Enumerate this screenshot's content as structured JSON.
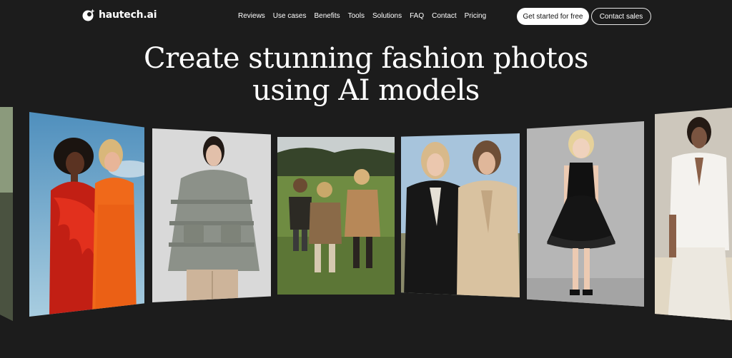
{
  "brand": {
    "name": "hautech.ai",
    "logo_icon": "hautech-logo-icon"
  },
  "nav": {
    "items": [
      {
        "label": "Reviews"
      },
      {
        "label": "Use cases"
      },
      {
        "label": "Benefits"
      },
      {
        "label": "Tools"
      },
      {
        "label": "Solutions"
      },
      {
        "label": "FAQ"
      },
      {
        "label": "Contact"
      },
      {
        "label": "Pricing"
      }
    ]
  },
  "cta": {
    "primary_label": "Get started for free",
    "secondary_label": "Contact sales"
  },
  "hero": {
    "title_line1": "Create stunning fashion photos",
    "title_line2": "using AI models"
  },
  "carousel": {
    "cards": [
      {
        "name": "edge-left-photo"
      },
      {
        "name": "two-women-red-orange-dresses-photo"
      },
      {
        "name": "woman-grey-puffer-jacket-photo"
      },
      {
        "name": "children-running-field-photo"
      },
      {
        "name": "two-women-suits-photo"
      },
      {
        "name": "girl-black-tulle-dress-photo"
      },
      {
        "name": "woman-white-outfit-photo"
      }
    ]
  },
  "colors": {
    "background": "#1c1c1c",
    "text": "#ffffff",
    "primary_button_bg": "#ffffff",
    "primary_button_text": "#111111"
  }
}
